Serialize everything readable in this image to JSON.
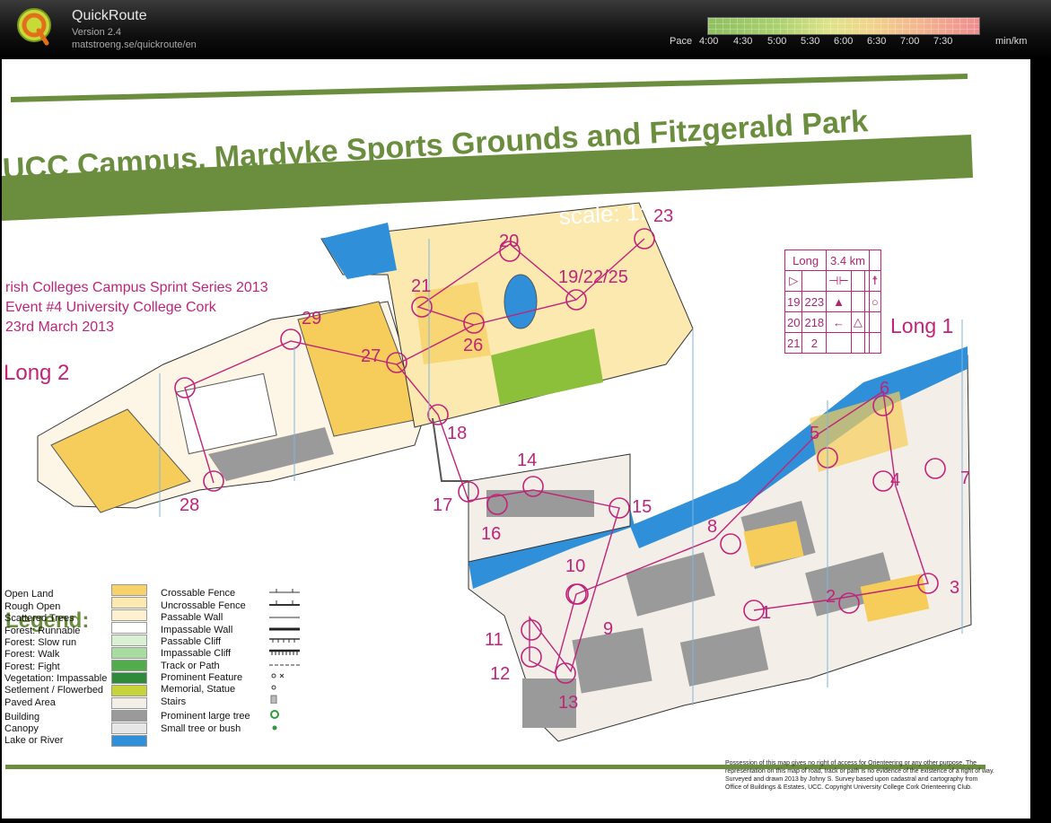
{
  "app": {
    "name": "QuickRoute",
    "version": "Version 2.4",
    "url": "matstroeng.se/quickroute/en"
  },
  "pace_scale": {
    "label": "Pace",
    "ticks": [
      "4:00",
      "4:30",
      "5:00",
      "5:30",
      "6:00",
      "6:30",
      "7:00",
      "7:30"
    ],
    "unit": "min/km",
    "colors": [
      "#8fbf5f",
      "#a9d06e",
      "#dfe38a",
      "#f1d48b",
      "#f3b58f",
      "#f08d8f"
    ]
  },
  "map": {
    "title": "UCC Campus, Mardyke Sports Grounds and Fitzgerald Park",
    "scale_text": "scale: 1:4000,  contours: 2.5 m",
    "event_lines": [
      "rish Colleges Campus Sprint Series 2013",
      "Event #4 University College Cork",
      "23rd March 2013"
    ],
    "course_labels": [
      "Long 2",
      "Long 1"
    ],
    "control_description": {
      "course": "Long",
      "length": "3.4 km",
      "rows": [
        {
          "num": "19",
          "code": "223"
        },
        {
          "num": "20",
          "code": "218"
        },
        {
          "num": "21",
          "code": "2"
        }
      ]
    },
    "controls": [
      "1",
      "2",
      "3",
      "4",
      "5",
      "6",
      "7",
      "8",
      "9",
      "10",
      "11",
      "12",
      "13",
      "14",
      "15",
      "16",
      "17",
      "18",
      "19/22/25",
      "20",
      "21",
      "23",
      "26",
      "27",
      "28",
      "29"
    ],
    "legend": {
      "title": "Legend:",
      "areas": [
        {
          "label": "Open Land",
          "color": "#f7d26a"
        },
        {
          "label": "Rough Open",
          "color": "#fbe9b0"
        },
        {
          "label": "Scattered Trees",
          "color": "#fdf1cf"
        },
        {
          "label": "Forest: Runnable",
          "color": "#ffffff"
        },
        {
          "label": "Forest: Slow run",
          "color": "#d9f0d2"
        },
        {
          "label": "Forest: Walk",
          "color": "#a9dca0"
        },
        {
          "label": "Forest: Fight",
          "color": "#4fae4a"
        },
        {
          "label": "Vegetation: Impassable",
          "color": "#2e8b3a"
        },
        {
          "label": "Setlement / Flowerbed",
          "color": "#c6d43a"
        },
        {
          "label": "Paved Area",
          "color": "#f3efe8"
        },
        {
          "label": "Building",
          "color": "#9a9a9a"
        },
        {
          "label": "Canopy",
          "color": "#e6e6e6"
        },
        {
          "label": "Lake or River",
          "color": "#2f8fd8"
        }
      ],
      "symbols": [
        "Crossable Fence",
        "Uncrossable Fence",
        "Passable Wall",
        "Impassable Wall",
        "Passable Cliff",
        "Impassable Cliff",
        "Track or Path",
        "Prominent Feature",
        "Memorial, Statue",
        "Stairs",
        "Prominent large tree",
        "Small tree or bush"
      ]
    },
    "copyright": "Possession of this map gives no right of access for Orienteering or any other purpose. The representation on this map of road, track or path is no evidence of the existence of a right of way. Surveyed and drawn 2013 by Johny S. Survey based upon cadastral and cartography from Office of Buildings & Estates, UCC. Copyright University College Cork Orienteering Club."
  }
}
